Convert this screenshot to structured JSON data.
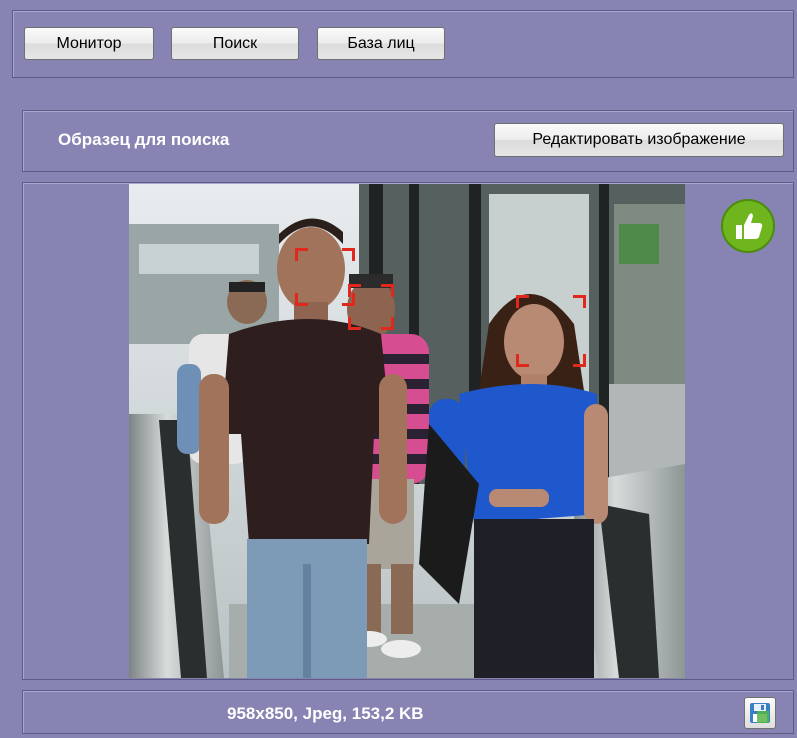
{
  "toolbar": {
    "monitor_label": "Монитор",
    "search_label": "Поиск",
    "face_db_label": "База лиц"
  },
  "sample": {
    "title": "Образец для поиска",
    "edit_button_label": "Редактировать изображение"
  },
  "image": {
    "info": "958x850, Jpeg, 153,2 KB",
    "status_icon": "thumbs-up-icon",
    "save_icon": "save-icon"
  },
  "colors": {
    "background": "#8784b4",
    "face_frame": "#e0281c",
    "approve": "#6fb51e"
  }
}
